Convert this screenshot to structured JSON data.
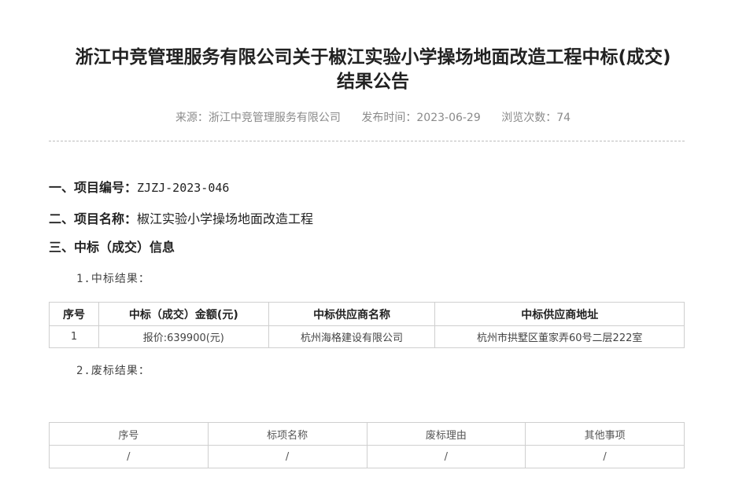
{
  "article": {
    "title_line1": "浙江中竞管理服务有限公司关于椒江实验小学操场地面改造工程中标(成交)",
    "title_line2": "结果公告",
    "source": "来源：浙江中竞管理服务有限公司",
    "publish_time": "发布时间：2023-06-29",
    "views": "浏览次数：74"
  },
  "sections": {
    "s1_label": "一、项目编号：",
    "s1_value": "ZJZJ-2023-046",
    "s2_label": "二、项目名称：",
    "s2_value": "椒江实验小学操场地面改造工程",
    "s3_label": "三、中标（成交）信息",
    "sub1": "1.中标结果：",
    "sub2": "2.废标结果："
  },
  "win_table": {
    "headers": [
      "序号",
      "中标（成交）金额(元)",
      "中标供应商名称",
      "中标供应商地址"
    ],
    "rows": [
      [
        "1",
        "报价:639900(元)",
        "杭州海格建设有限公司",
        "杭州市拱墅区董家弄60号二层222室"
      ]
    ]
  },
  "fail_table": {
    "headers": [
      "序号",
      "标项名称",
      "废标理由",
      "其他事项"
    ],
    "rows": [
      [
        "/",
        "/",
        "/",
        "/"
      ]
    ]
  }
}
